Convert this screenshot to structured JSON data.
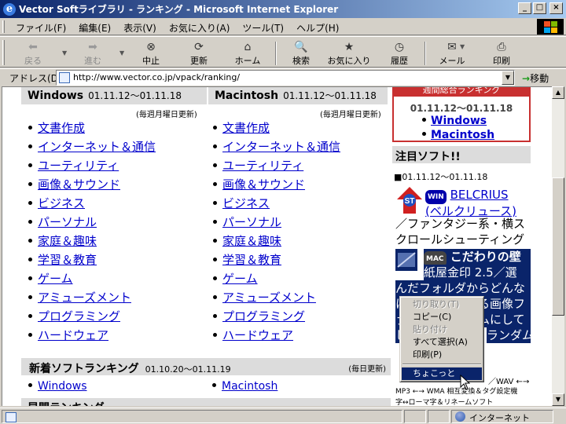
{
  "window": {
    "title": "Vector Softライブラリ - ランキング - Microsoft Internet Explorer",
    "controls": {
      "minimize": "_",
      "maximize": "□",
      "close": "×"
    }
  },
  "menu": [
    "ファイル(F)",
    "編集(E)",
    "表示(V)",
    "お気に入り(A)",
    "ツール(T)",
    "ヘルプ(H)"
  ],
  "toolbar": {
    "back": "戻る",
    "forward": "進む",
    "stop": "中止",
    "refresh": "更新",
    "home": "ホーム",
    "search": "検索",
    "favorites": "お気に入り",
    "history": "履歴",
    "mail": "メール",
    "print": "印刷"
  },
  "address": {
    "label": "アドレス(D)",
    "url": "http://www.vector.co.jp/vpack/ranking/",
    "go": "移動"
  },
  "content": {
    "windows_head": {
      "title": "Windows",
      "date": "01.11.12～01.11.18",
      "note": "(毎週月曜日更新)"
    },
    "mac_head": {
      "title": "Macintosh",
      "date": "01.11.12～01.11.18",
      "note": "(毎週月曜日更新)"
    },
    "categories": [
      "文書作成",
      "インターネット＆通信",
      "ユーティリティ",
      "画像＆サウンド",
      "ビジネス",
      "パーソナル",
      "家庭＆趣味",
      "学習＆教育",
      "ゲーム",
      "アミューズメント",
      "プログラミング",
      "ハードウェア"
    ],
    "weekly": {
      "header": "週間総合ランキング",
      "date": "01.11.12～01.11.18",
      "links": [
        "Windows",
        "Macintosh"
      ]
    },
    "notable": {
      "title": "注目ソフト!!",
      "date": "■01.11.12～01.11.18",
      "badge": "WIN",
      "app_name": "BELCRIUS",
      "app_reading": "(ベルクリュース)",
      "app_desc": "／ファンタジー系・横スクロールシューティング",
      "app2_badge": "MAC",
      "app2_name": "こだわりの壁",
      "app2_lines": [
        "紙屋金印 2.5／選",
        "んだフォルダからどんな",
        "に深い階層にある画像フ",
        "ァイルもランダムにして",
        "ランダムアップ",
        "し"
      ],
      "tail_1": "／WAV ←→",
      "tail_2": "MP3 ←→ WMA 相互変換＆タグ設定機",
      "tail_3": "字↔ローマ字＆リネームソフト"
    },
    "new_head": {
      "title": "新着ソフトランキング",
      "date": "01.10.20～01.11.19",
      "note": "(毎日更新)"
    },
    "new_links": [
      "Windows",
      "Macintosh"
    ],
    "cut_heading": "早間ランキング"
  },
  "context_menu": {
    "items": [
      "切り取り(T)",
      "コピー(C)",
      "貼り付け",
      "すべて選択(A)",
      "印刷(P)",
      "ちょこっと"
    ],
    "disabled": [
      0,
      2
    ],
    "selected": 5
  },
  "status": {
    "zone": "インターネット"
  }
}
